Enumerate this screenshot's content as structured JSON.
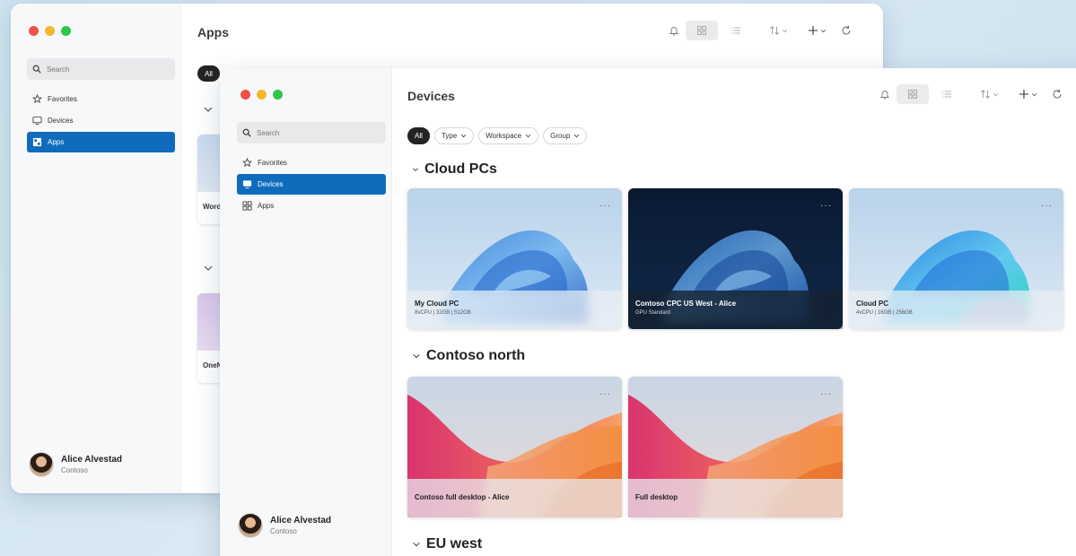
{
  "back_window": {
    "title": "Apps",
    "search_placeholder": "Search",
    "nav": [
      {
        "label": "Favorites"
      },
      {
        "label": "Devices"
      },
      {
        "label": "Apps"
      }
    ],
    "filter_all": "All",
    "cards": [
      {
        "label": "Word"
      },
      {
        "label": "OneNote"
      }
    ],
    "user": {
      "name": "Alice Alvestad",
      "org": "Contoso"
    }
  },
  "front_window": {
    "title": "Devices",
    "search_placeholder": "Search",
    "nav": [
      {
        "label": "Favorites"
      },
      {
        "label": "Devices"
      },
      {
        "label": "Apps"
      }
    ],
    "filters": [
      {
        "label": "All"
      },
      {
        "label": "Type"
      },
      {
        "label": "Workspace"
      },
      {
        "label": "Group"
      }
    ],
    "sections": [
      {
        "title": "Cloud PCs",
        "cards": [
          {
            "name": "My Cloud PC",
            "spec": "8vCPU | 32GB | 512GB"
          },
          {
            "name": "Contoso CPC US West - Alice",
            "spec": "GPU Standard"
          },
          {
            "name": "Cloud PC",
            "spec": "4vCPU | 16GB | 256GB"
          }
        ]
      },
      {
        "title": "Contoso north",
        "cards": [
          {
            "name": "Contoso full desktop - Alice"
          },
          {
            "name": "Full desktop"
          }
        ]
      },
      {
        "title": "EU west"
      }
    ],
    "more_glyph": "···",
    "user": {
      "name": "Alice Alvestad",
      "org": "Contoso"
    }
  },
  "colors": {
    "accent": "#0f6cbd",
    "traffic_red": "#f2514a",
    "traffic_yellow": "#f3b82e",
    "traffic_green": "#2ec64b"
  }
}
